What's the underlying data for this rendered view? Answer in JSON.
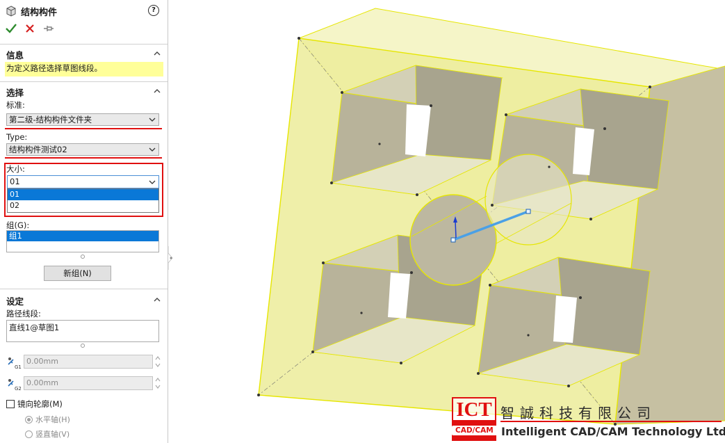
{
  "panel": {
    "title": "结构构件",
    "help_label": "?",
    "info": {
      "header": "信息",
      "message": "为定义路径选择草图线段。"
    },
    "selection": {
      "header": "选择",
      "standard_label": "标准:",
      "standard_value": "第二级-结构构件文件夹",
      "type_label": "Type:",
      "type_value": "结构构件测试02",
      "size_label": "大小:",
      "size_value": "01",
      "size_options": [
        "01",
        "02"
      ],
      "group_label": "组(G):",
      "groups": [
        "组1"
      ],
      "new_group_button": "新组(N)"
    },
    "settings": {
      "header": "设定",
      "path_label": "路径线段:",
      "path_value": "直线1@草图1",
      "offset1_value": "0.00mm",
      "offset2_value": "0.00mm",
      "mirror_label": "镜向轮廓(M)",
      "horizontal_axis": "水平轴(H)",
      "vertical_axis": "竖直轴(V)"
    }
  },
  "logo": {
    "abbr": "ICT",
    "sub": "CAD/CAM",
    "chinese": "智誠科技有限公司",
    "english": "Intelligent CAD/CAM Technology Ltd."
  },
  "colors": {
    "accent": "#0a78d7",
    "highlight": "#ffff99",
    "alert_red": "#e01010",
    "part_fill": "#ecec9a",
    "part_edge": "#e6e600"
  }
}
